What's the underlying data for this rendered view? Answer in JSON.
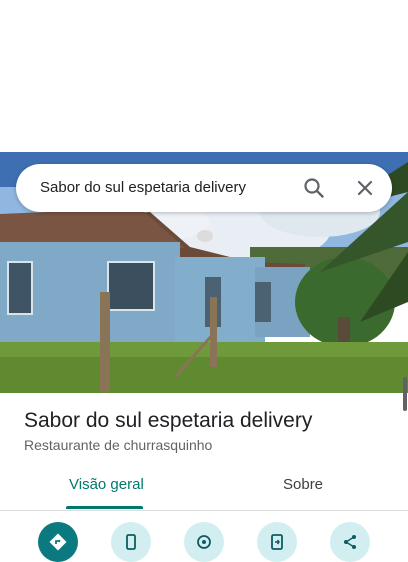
{
  "search": {
    "query": "Sabor do sul espetaria delivery"
  },
  "place": {
    "name": "Sabor do sul espetaria delivery",
    "category": "Restaurante de churrasquinho"
  },
  "tabs": [
    {
      "label": "Visão geral",
      "selected": true
    },
    {
      "label": "Sobre",
      "selected": false
    }
  ],
  "actions": [
    {
      "icon": "directions-icon"
    },
    {
      "icon": "phone-icon"
    },
    {
      "icon": "nearby-icon"
    },
    {
      "icon": "send-to-phone-icon"
    },
    {
      "icon": "share-icon"
    }
  ],
  "colors": {
    "accent": "#00796b",
    "action_primary": "#0b7a80",
    "action_secondary": "#d2eef0"
  }
}
